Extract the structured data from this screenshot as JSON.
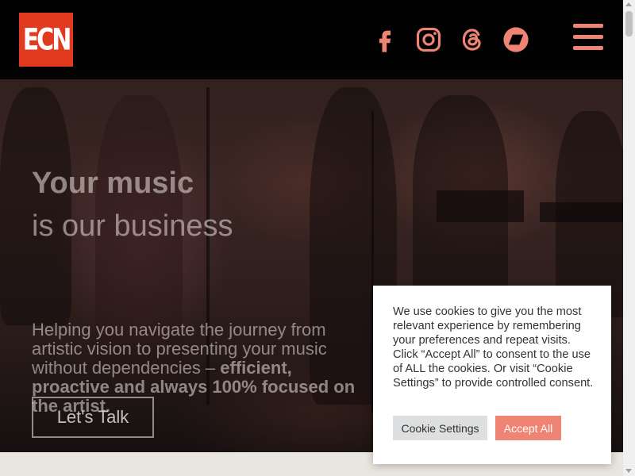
{
  "header": {
    "logo_text": "ECN",
    "social_icons": [
      "facebook-icon",
      "instagram-icon",
      "threads-icon",
      "bandcamp-icon"
    ],
    "menu_icon": "hamburger-menu-icon",
    "accent_color": "#f08474",
    "logo_color": "#e23a1f"
  },
  "hero": {
    "title_line1": "Your music",
    "title_line2": "is our business",
    "subtitle_regular": "Helping you navigate the journey from artistic vision to presenting your music without dependencies –",
    "subtitle_bold": "efficient, proactive and always 100% focused on the artist.",
    "cta_label": "Let's Talk"
  },
  "cookie_banner": {
    "message": "We use cookies to give you the most relevant experience by remembering your preferences and repeat visits. Click “Accept All” to consent to the use of ALL the cookies. Or visit “Cookie Settings” to provide controlled consent.",
    "settings_label": "Cookie Settings",
    "accept_label": "Accept All"
  }
}
